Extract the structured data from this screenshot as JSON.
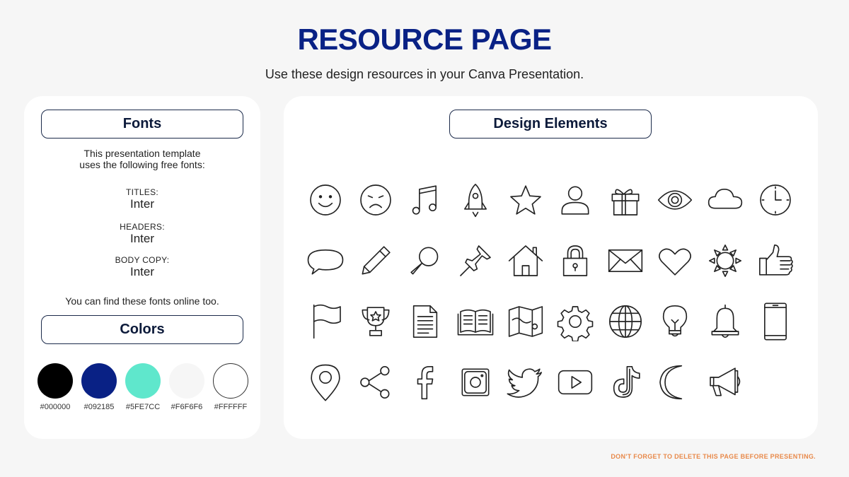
{
  "page": {
    "title": "RESOURCE PAGE",
    "subtitle": "Use these design resources in your Canva Presentation.",
    "footer_note": "DON'T FORGET TO DELETE THIS PAGE BEFORE PRESENTING."
  },
  "fonts": {
    "heading": "Fonts",
    "intro": "This presentation template\nuses the following free fonts:",
    "entries": [
      {
        "label": "TITLES:",
        "font": "Inter"
      },
      {
        "label": "HEADERS:",
        "font": "Inter"
      },
      {
        "label": "BODY COPY:",
        "font": "Inter"
      }
    ],
    "note": "You can find these fonts online too."
  },
  "colors": {
    "heading": "Colors",
    "swatches": [
      {
        "hex": "#000000",
        "label": "#000000"
      },
      {
        "hex": "#092185",
        "label": "#092185"
      },
      {
        "hex": "#5FE7CC",
        "label": "#5FE7CC"
      },
      {
        "hex": "#F6F6F6",
        "label": "#F6F6F6"
      },
      {
        "hex": "#FFFFFF",
        "label": "#FFFFFF"
      }
    ]
  },
  "design_elements": {
    "heading": "Design Elements",
    "icons": [
      "smile-icon",
      "sad-icon",
      "music-note-icon",
      "rocket-icon",
      "star-icon",
      "user-icon",
      "gift-icon",
      "eye-icon",
      "cloud-icon",
      "clock-icon",
      "speech-bubble-icon",
      "pencil-icon",
      "magnifier-icon",
      "pushpin-icon",
      "house-icon",
      "padlock-icon",
      "envelope-icon",
      "heart-icon",
      "sun-icon",
      "thumbs-up-icon",
      "flag-icon",
      "trophy-icon",
      "document-icon",
      "open-book-icon",
      "map-icon",
      "gear-icon",
      "globe-icon",
      "lightbulb-icon",
      "bell-icon",
      "smartphone-icon",
      "location-pin-icon",
      "share-icon",
      "facebook-icon",
      "instagram-icon",
      "twitter-icon",
      "youtube-icon",
      "tiktok-icon",
      "moon-icon",
      "megaphone-icon"
    ]
  }
}
